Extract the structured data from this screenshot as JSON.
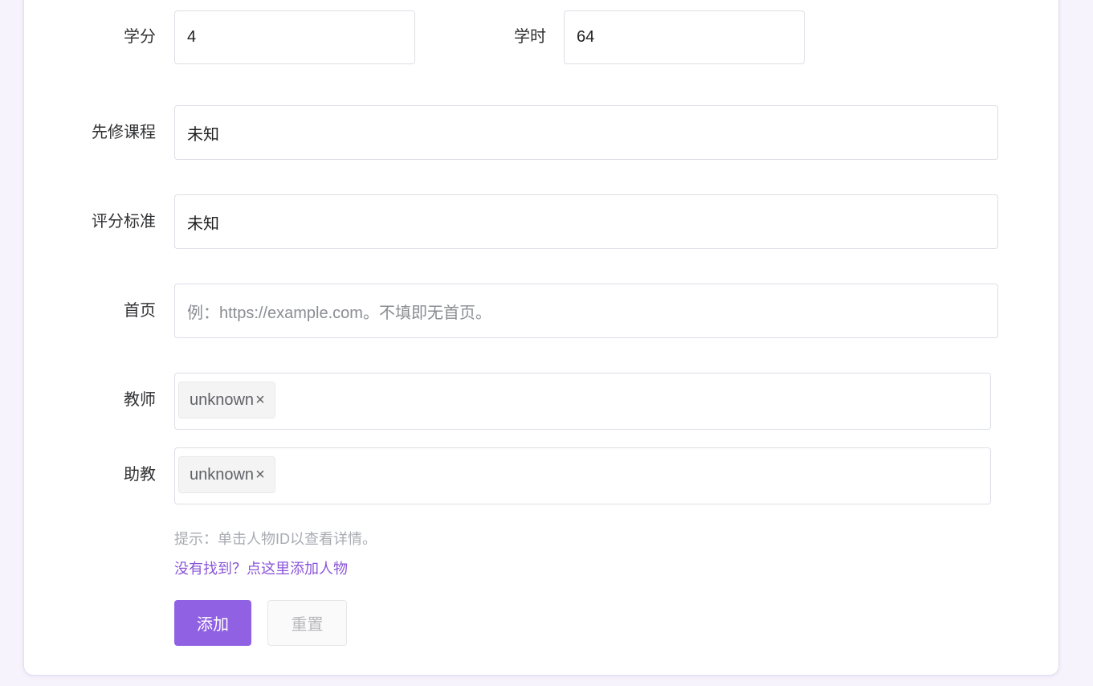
{
  "form": {
    "credits": {
      "label": "学分",
      "value": "4"
    },
    "hours": {
      "label": "学时",
      "value": "64"
    },
    "prerequisites": {
      "label": "先修课程",
      "value": "未知"
    },
    "grading": {
      "label": "评分标准",
      "value": "未知"
    },
    "homepage": {
      "label": "首页",
      "value": "",
      "placeholder": "例：https://example.com。不填即无首页。"
    },
    "teachers": {
      "label": "教师",
      "tags": [
        "unknown"
      ]
    },
    "assistants": {
      "label": "助教",
      "tags": [
        "unknown"
      ]
    },
    "hint": "提示：单击人物ID以查看详情。",
    "add_person_link": "没有找到？点这里添加人物",
    "tag_close_glyph": "×"
  },
  "buttons": {
    "submit_label": "添加",
    "reset_label": "重置"
  },
  "colors": {
    "accent": "#9061e3",
    "link": "#8a55d9",
    "background": "#f6f3fd"
  }
}
